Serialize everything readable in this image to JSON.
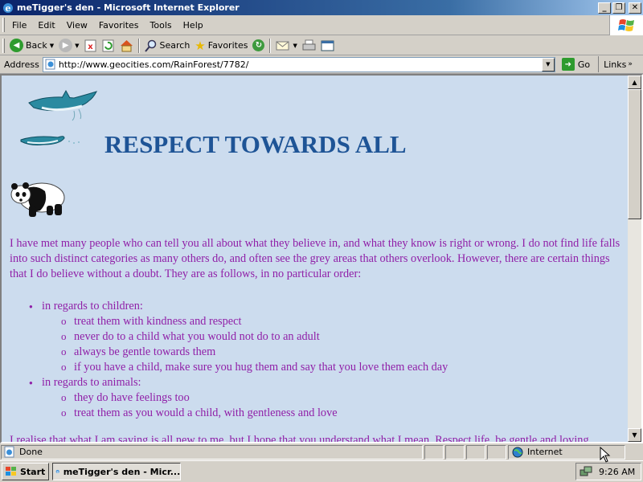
{
  "window": {
    "title": "meTigger's den - Microsoft Internet Explorer"
  },
  "menu": [
    "File",
    "Edit",
    "View",
    "Favorites",
    "Tools",
    "Help"
  ],
  "toolbar": {
    "back_label": "Back",
    "search_label": "Search",
    "favorites_label": "Favorites"
  },
  "address": {
    "label": "Address",
    "url": "http://www.geocities.com/RainForest/7782/",
    "go_label": "Go",
    "links_label": "Links"
  },
  "page": {
    "heading": "RESPECT TOWARDS ALL",
    "intro": "I have met many people who can tell you all about what they believe in, and what they know is right or wrong. I do not find life falls into such distinct categories as many others do, and often see the grey areas that others overlook. However, there are certain things that I do believe without a doubt. They are as follows, in no particular order:",
    "groups": [
      {
        "label": "in regards to children:",
        "items": [
          "treat them with kindness and respect",
          "never do to a child what you would not do to an adult",
          "always be gentle towards them",
          "if you have a child, make sure you hug them and say that you love them each day"
        ]
      },
      {
        "label": "in regards to animals:",
        "items": [
          "they do have feelings too",
          "treat them as you would a child, with gentleness and love"
        ]
      }
    ],
    "cutoff": "I realise that what I am saying is all new to me, but I hope that you understand what I mean. Respect life, be gentle and loving"
  },
  "status": {
    "text": "Done",
    "zone": "Internet"
  },
  "taskbar": {
    "start_label": "Start",
    "task_label": "meTigger's den - Micr...",
    "clock": "9:26 AM"
  },
  "colors": {
    "page_bg": "#ccdcee",
    "heading": "#1e5496",
    "body_text": "#9020a8"
  }
}
